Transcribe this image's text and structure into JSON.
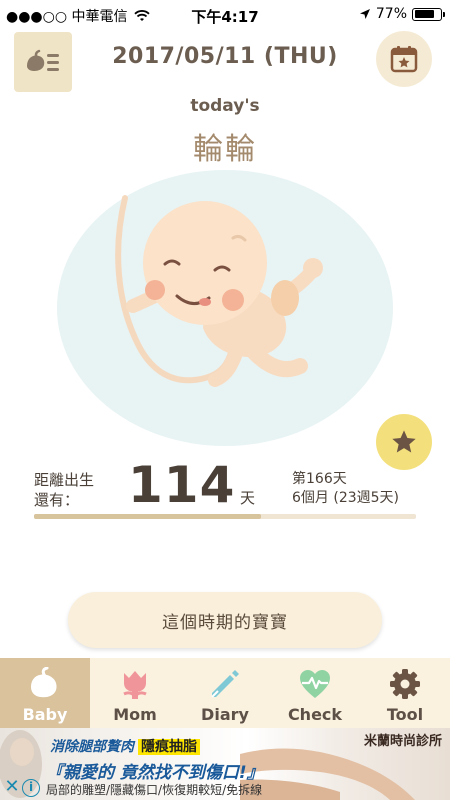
{
  "status_bar": {
    "carrier": "●●●○○ 中華電信",
    "time": "下午4:17",
    "battery": "77%",
    "battery_level": 0.77
  },
  "header": {
    "date": "2017/05/11 (THU)",
    "subtitle": "today's",
    "baby_name": "輪輪"
  },
  "countdown": {
    "label_line1": "距離出生",
    "label_line2": "還有：",
    "days_left": "114",
    "unit": "天",
    "day_number": "第166天",
    "age_detail": "6個月 (23週5天)",
    "progress_fraction": 0.593
  },
  "period_button": "這個時期的寶寶",
  "tabs": [
    {
      "label": "Baby",
      "active": true
    },
    {
      "label": "Mom",
      "active": false
    },
    {
      "label": "Diary",
      "active": false
    },
    {
      "label": "Check",
      "active": false
    },
    {
      "label": "Tool",
      "active": false
    }
  ],
  "ad": {
    "headline": "消除腿部贅肉",
    "tag": "隱痕抽脂",
    "slogan": "『親愛的 竟然找不到傷口!』",
    "details": "局部的雕塑/隱藏傷口/恢復期較短/免拆線",
    "brand": "米蘭時尚診所",
    "close_symbol": "✕",
    "info_symbol": "i"
  },
  "colors": {
    "tab_active": "#d9c29c",
    "tab_bar": "#faf1df",
    "accent_gold": "#d7c39c",
    "star_button": "#f3e07c",
    "text_brown": "#6b5d50"
  }
}
